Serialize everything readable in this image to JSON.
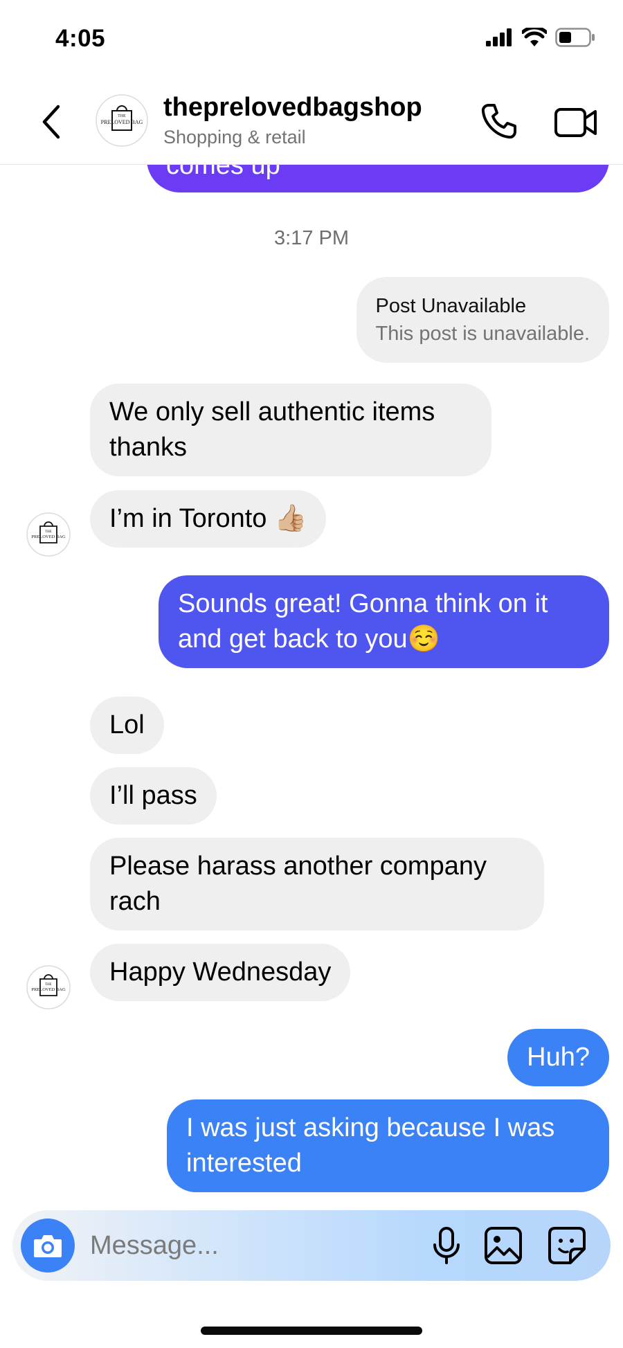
{
  "status_bar": {
    "time": "4:05"
  },
  "header": {
    "account_name": "theprelovedbagshop",
    "category": "Shopping & retail",
    "avatar_text_top": "THE",
    "avatar_text_main": "PRELOVED BAG"
  },
  "chat": {
    "partial_prev_message": "comes up",
    "timestamp": "3:17 PM",
    "shared_post": {
      "title": "Post Unavailable",
      "subtitle": "This post is unavailable."
    },
    "messages": [
      {
        "from": "them",
        "text": "We only sell authentic items thanks"
      },
      {
        "from": "them",
        "text": "I’m in Toronto 👍🏼"
      },
      {
        "from": "me",
        "text": "Sounds great! Gonna think on it and get back to you☺️"
      },
      {
        "from": "them",
        "text": "Lol"
      },
      {
        "from": "them",
        "text": "I’ll pass"
      },
      {
        "from": "them",
        "text": "Please harass another company rach"
      },
      {
        "from": "them",
        "text": "Happy Wednesday"
      },
      {
        "from": "me",
        "text": "Huh?"
      },
      {
        "from": "me",
        "text": "I was just asking because I was interested"
      }
    ]
  },
  "composer": {
    "placeholder": "Message..."
  },
  "colors": {
    "outgoing_purple": "#6c3cf5",
    "outgoing_indigo": "#4f55ef",
    "outgoing_blue": "#3b82f6",
    "incoming_gray": "#efefef"
  }
}
